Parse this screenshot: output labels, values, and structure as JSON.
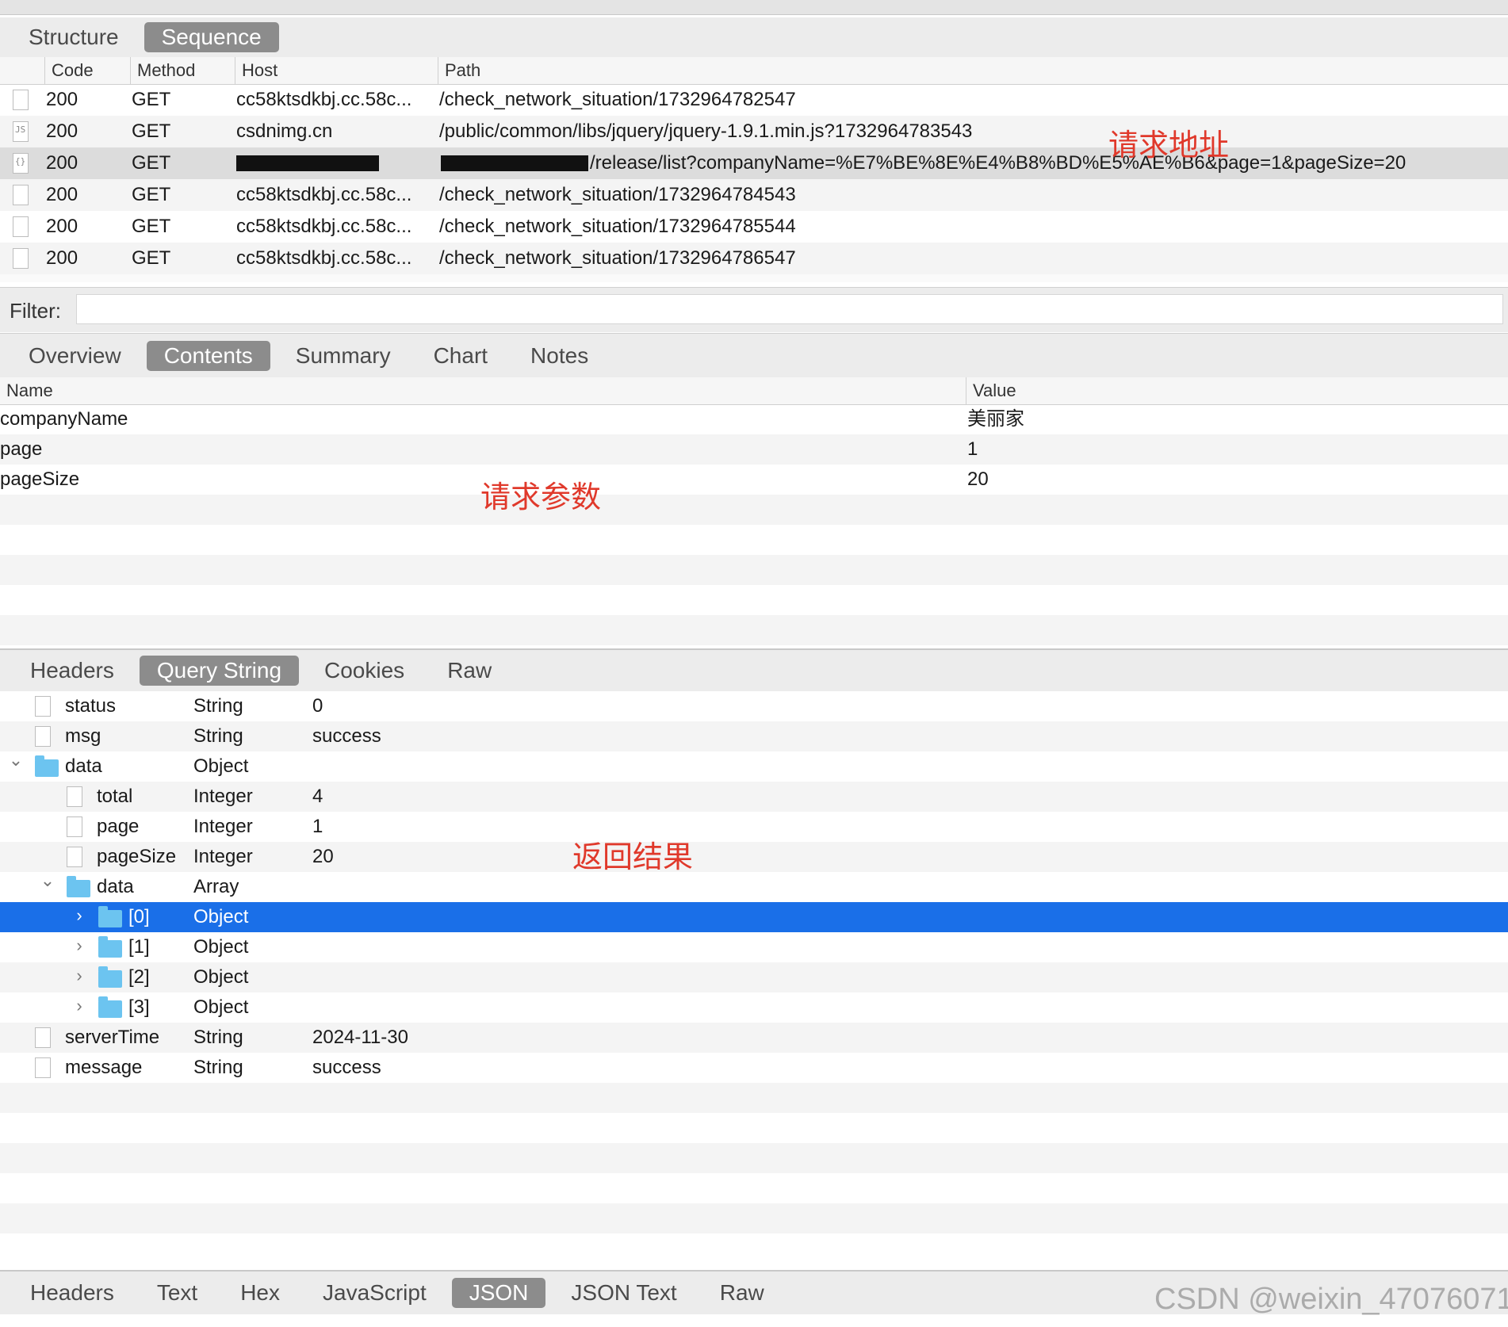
{
  "top_tabs": [
    "Structure",
    "Sequence"
  ],
  "top_tabs_active": 1,
  "sequence_table": {
    "columns": [
      "Code",
      "Method",
      "Host",
      "Path"
    ],
    "rows": [
      {
        "icon": "",
        "code": "200",
        "method": "GET",
        "host": "cc58ktsdkbj.cc.58c...",
        "path": "/check_network_situation/1732964782547"
      },
      {
        "icon": "JS",
        "code": "200",
        "method": "GET",
        "host": "csdnimg.cn",
        "path": "/public/common/libs/jquery/jquery-1.9.1.min.js?1732964783543"
      },
      {
        "icon": "{}",
        "code": "200",
        "method": "GET",
        "host": "",
        "path": "/release/list?companyName=%E7%BE%8E%E4%B8%BD%E5%AE%B6&page=1&pageSize=20"
      },
      {
        "icon": "",
        "code": "200",
        "method": "GET",
        "host": "cc58ktsdkbj.cc.58c...",
        "path": "/check_network_situation/1732964784543"
      },
      {
        "icon": "",
        "code": "200",
        "method": "GET",
        "host": "cc58ktsdkbj.cc.58c...",
        "path": "/check_network_situation/1732964785544"
      },
      {
        "icon": "",
        "code": "200",
        "method": "GET",
        "host": "cc58ktsdkbj.cc.58c...",
        "path": "/check_network_situation/1732964786547"
      }
    ]
  },
  "filter": {
    "label": "Filter:",
    "value": ""
  },
  "middle_tabs": [
    "Overview",
    "Contents",
    "Summary",
    "Chart",
    "Notes"
  ],
  "middle_tabs_active": 1,
  "params_table": {
    "columns": [
      "Name",
      "Value"
    ],
    "rows": [
      {
        "name": "companyName",
        "value": "美丽家"
      },
      {
        "name": "page",
        "value": "1"
      },
      {
        "name": "pageSize",
        "value": "20"
      }
    ]
  },
  "request_tabs": [
    "Headers",
    "Query String",
    "Cookies",
    "Raw"
  ],
  "request_tabs_active": 1,
  "json_tree": [
    {
      "indent": 0,
      "kind": "doc",
      "name": "status",
      "type": "String",
      "value": "0"
    },
    {
      "indent": 0,
      "kind": "doc",
      "name": "msg",
      "type": "String",
      "value": "success"
    },
    {
      "indent": 0,
      "kind": "folder",
      "expanded": true,
      "name": "data",
      "type": "Object",
      "value": ""
    },
    {
      "indent": 1,
      "kind": "doc",
      "name": "total",
      "type": "Integer",
      "value": "4"
    },
    {
      "indent": 1,
      "kind": "doc",
      "name": "page",
      "type": "Integer",
      "value": "1"
    },
    {
      "indent": 1,
      "kind": "doc",
      "name": "pageSize",
      "type": "Integer",
      "value": "20"
    },
    {
      "indent": 1,
      "kind": "folder",
      "expanded": true,
      "name": "data",
      "type": "Array",
      "value": ""
    },
    {
      "indent": 2,
      "kind": "folder",
      "expanded": false,
      "name": "[0]",
      "type": "Object",
      "value": "",
      "selected": true
    },
    {
      "indent": 2,
      "kind": "folder",
      "expanded": false,
      "name": "[1]",
      "type": "Object",
      "value": ""
    },
    {
      "indent": 2,
      "kind": "folder",
      "expanded": false,
      "name": "[2]",
      "type": "Object",
      "value": ""
    },
    {
      "indent": 2,
      "kind": "folder",
      "expanded": false,
      "name": "[3]",
      "type": "Object",
      "value": ""
    },
    {
      "indent": 0,
      "kind": "doc",
      "name": "serverTime",
      "type": "String",
      "value": "2024-11-30"
    },
    {
      "indent": 0,
      "kind": "doc",
      "name": "message",
      "type": "String",
      "value": "success"
    }
  ],
  "response_tabs": [
    "Headers",
    "Text",
    "Hex",
    "JavaScript",
    "JSON",
    "JSON Text",
    "Raw"
  ],
  "response_tabs_active": 4,
  "annotations": {
    "request_url": "请求地址",
    "request_params": "请求参数",
    "response_result": "返回结果"
  },
  "watermark": "CSDN @weixin_47076071",
  "colors": {
    "selection": "#1a6fe8",
    "annotation": "#e0392b",
    "folder": "#6cc4f0",
    "active_tab": "#8c8c8c"
  }
}
